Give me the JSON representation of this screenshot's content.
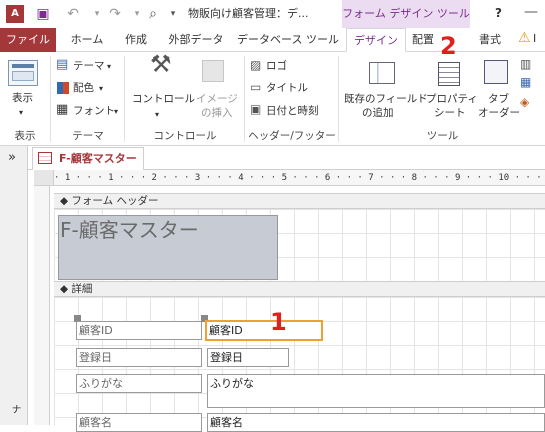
{
  "title": "物販向け顧客管理：デ...",
  "context_tab_label": "フォーム デザイン ツール",
  "help": "?",
  "tabs": [
    "ファイル",
    "ホーム",
    "作成",
    "外部データ",
    "データベース ツール",
    "デザイン",
    "配置",
    "書式"
  ],
  "ribbon": {
    "view_label": "表示",
    "theme_label": "テーマ",
    "color_label": "配色",
    "font_label": "フォント",
    "control_label": "コントロール",
    "image_label1": "イメージ",
    "image_label2": "の挿入",
    "logo_label": "ロゴ",
    "title_label": "タイトル",
    "datetime_label": "日付と時刻",
    "existing_field1": "既存のフィールド",
    "existing_field2": "の追加",
    "property1": "プロパティ",
    "property2": "シート",
    "taborder1": "タブ",
    "taborder2": "オーダー",
    "groups": {
      "view": "表示",
      "theme": "テーマ",
      "control": "コントロール",
      "header": "ヘッダー/フッター",
      "tools": "ツール"
    }
  },
  "document": {
    "tab_label": "F-顧客マスター",
    "nav_toggle": "»",
    "ruler_text": "· 1 · · · 1 · · · 2 · · · 3 · · · 4 · · · 5 · · · 6 · · · 7 · · · 8 · · · 9 · · · 10 · · · 11 · · · 12",
    "form_header_label": "フォーム ヘッダー",
    "form_title": "F-顧客マスター",
    "detail_label": "詳細",
    "fields": [
      {
        "label": "顧客ID",
        "control": "顧客ID"
      },
      {
        "label": "登録日",
        "control": "登録日"
      },
      {
        "label": "ふりがな",
        "control": "ふりがな"
      },
      {
        "label": "顧客名",
        "control": "顧客名"
      }
    ]
  },
  "annotations": {
    "one": "1",
    "two": "2"
  },
  "colors": {
    "file_tab": "#a4373a",
    "context": "#ebdcf1",
    "accent": "#7a2f8a",
    "annotation": "#e0201b",
    "selection": "#f0a030"
  }
}
